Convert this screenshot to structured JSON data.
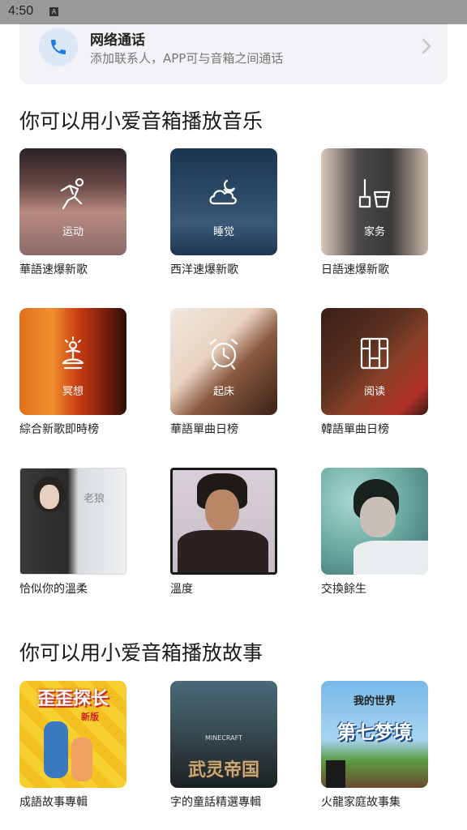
{
  "status_bar": {
    "time": "4:50",
    "badge": "A"
  },
  "call_card": {
    "icon": "phone-icon",
    "title": "网络通话",
    "subtitle": "添加联系人，APP可与音箱之间通话"
  },
  "music_section": {
    "title": "你可以用小爱音箱播放音乐",
    "items": [
      {
        "caption": "运动",
        "label": "華語速爆新歌",
        "icon": "running-icon"
      },
      {
        "caption": "睡觉",
        "label": "西洋速爆新歌",
        "icon": "cloud-moon-icon"
      },
      {
        "caption": "家务",
        "label": "日語速爆新歌",
        "icon": "mop-bucket-icon"
      },
      {
        "caption": "冥想",
        "label": "綜合新歌即時榜",
        "icon": "meditation-icon"
      },
      {
        "caption": "起床",
        "label": "華語單曲日榜",
        "icon": "alarm-clock-icon"
      },
      {
        "caption": "阅读",
        "label": "韓語單曲日榜",
        "icon": "bookshelf-icon"
      },
      {
        "caption": "",
        "label": "恰似你的溫柔",
        "cover_text": "老狼"
      },
      {
        "caption": "",
        "label": "溫度"
      },
      {
        "caption": "",
        "label": "交換餘生"
      }
    ]
  },
  "story_section": {
    "title": "你可以用小爱音箱播放故事",
    "items": [
      {
        "label": "成語故事專輯",
        "cover_title": "歪歪探长",
        "cover_sub": "新版"
      },
      {
        "label": "字的童話精選專輯",
        "cover_title": "武灵帝国",
        "cover_sub": "MINECRAFT"
      },
      {
        "label": "火龍家庭故事集",
        "cover_title": "第七梦境",
        "cover_sub": "我的世界"
      }
    ]
  },
  "colors": {
    "accent": "#1f7bea",
    "card_bg": "#f2f3f6"
  }
}
